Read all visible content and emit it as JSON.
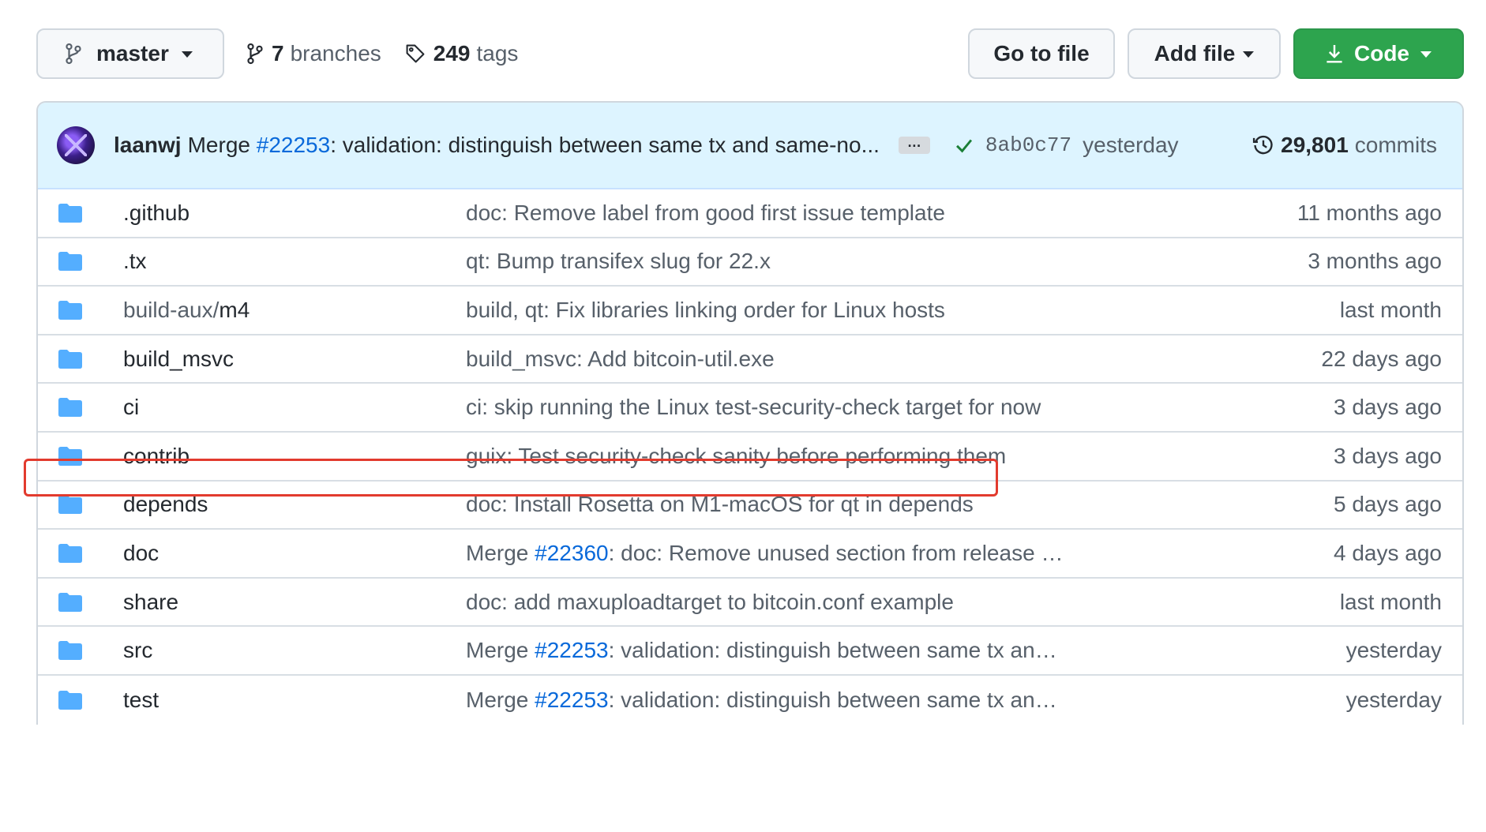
{
  "toolbar": {
    "branch": "master",
    "branches_count": "7",
    "branches_label": "branches",
    "tags_count": "249",
    "tags_label": "tags",
    "go_to_file": "Go to file",
    "add_file": "Add file",
    "code": "Code"
  },
  "commit": {
    "author": "laanwj",
    "message_prefix": "Merge",
    "pr": "#22253",
    "message_rest": ": validation: distinguish between same tx and same-no...",
    "more": "…",
    "sha": "8ab0c77",
    "when": "yesterday",
    "commits_count": "29,801",
    "commits_label": "commits"
  },
  "files": [
    {
      "name": ".github",
      "dim": "",
      "prefix": "doc: Remove label from good first issue template",
      "pr": "",
      "suffix": "",
      "age": "11 months ago"
    },
    {
      "name": ".tx",
      "dim": "",
      "prefix": "qt: Bump transifex slug for 22.x",
      "pr": "",
      "suffix": "",
      "age": "3 months ago"
    },
    {
      "name": "m4",
      "dim": "build-aux/",
      "prefix": "build, qt: Fix libraries linking order for Linux hosts",
      "pr": "",
      "suffix": "",
      "age": "last month"
    },
    {
      "name": "build_msvc",
      "dim": "",
      "prefix": "build_msvc: Add bitcoin-util.exe",
      "pr": "",
      "suffix": "",
      "age": "22 days ago"
    },
    {
      "name": "ci",
      "dim": "",
      "prefix": "ci: skip running the Linux test-security-check target for now",
      "pr": "",
      "suffix": "",
      "age": "3 days ago"
    },
    {
      "name": "contrib",
      "dim": "",
      "prefix": "guix: Test security-check sanity before performing them",
      "pr": "",
      "suffix": "",
      "age": "3 days ago"
    },
    {
      "name": "depends",
      "dim": "",
      "prefix": "doc: Install Rosetta on M1-macOS for qt in depends",
      "pr": "",
      "suffix": "",
      "age": "5 days ago"
    },
    {
      "name": "doc",
      "dim": "",
      "prefix": "Merge ",
      "pr": "#22360",
      "suffix": ": doc: Remove unused section from release process",
      "age": "4 days ago"
    },
    {
      "name": "share",
      "dim": "",
      "prefix": "doc: add maxuploadtarget to bitcoin.conf example",
      "pr": "",
      "suffix": "",
      "age": "last month"
    },
    {
      "name": "src",
      "dim": "",
      "prefix": "Merge ",
      "pr": "#22253",
      "suffix": ": validation: distinguish between same tx and same-no...",
      "age": "yesterday"
    },
    {
      "name": "test",
      "dim": "",
      "prefix": "Merge ",
      "pr": "#22253",
      "suffix": ": validation: distinguish between same tx and same-no...",
      "age": "yesterday"
    }
  ],
  "colors": {
    "accent_link": "#0969da",
    "code_button": "#2da44e",
    "commit_bar": "#ddf4ff",
    "folder": "#54aeff",
    "highlight": "#e23b2e"
  }
}
